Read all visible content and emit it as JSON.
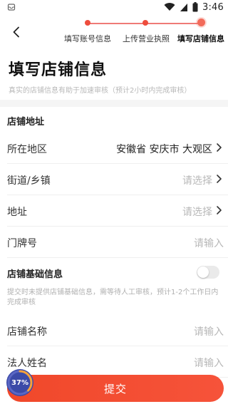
{
  "status_bar": {
    "time": "3:46"
  },
  "steps": [
    {
      "label": "填写账号信息",
      "state": "done"
    },
    {
      "label": "上传营业执照",
      "state": "done"
    },
    {
      "label": "填写店铺信息",
      "state": "current"
    }
  ],
  "page": {
    "title": "填写店铺信息",
    "subtitle": "真实的店铺信息有助于加速审核（预计2小时内完成审核）"
  },
  "address_section": {
    "title": "店铺地址",
    "rows": [
      {
        "label": "所在地区",
        "value": "安徽省 安庆市 大观区",
        "placeholder": false,
        "arrow": true
      },
      {
        "label": "街道/乡镇",
        "value": "请选择",
        "placeholder": true,
        "arrow": true
      },
      {
        "label": "地址",
        "value": "请选择",
        "placeholder": true,
        "arrow": true
      },
      {
        "label": "门牌号",
        "value": "请输入",
        "placeholder": true,
        "arrow": false
      }
    ]
  },
  "basic_section": {
    "title": "店铺基础信息",
    "toggle_on": false,
    "note": "提交时未提供店铺基础信息，需等待人工审核，预计1-2个工作日内完成审核",
    "rows": [
      {
        "label": "店铺名称",
        "value": "请输入",
        "placeholder": true
      },
      {
        "label": "法人姓名",
        "value": "请输入",
        "placeholder": true
      }
    ]
  },
  "submit": {
    "label": "提交"
  },
  "progress_badge": {
    "text": "37%",
    "percent": 37
  },
  "colors": {
    "accent": "#f0482a",
    "step": "#ee4d3d",
    "badge": "#3b4aa8",
    "placeholder": "#b8b8b8"
  }
}
